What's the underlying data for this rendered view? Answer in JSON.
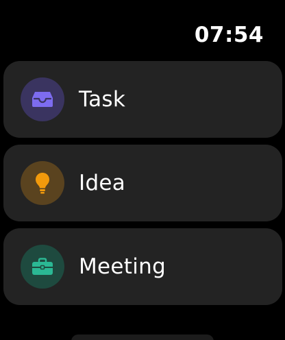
{
  "status_bar": {
    "time": "07:54"
  },
  "items": [
    {
      "label": "Task",
      "icon": "tray-icon",
      "icon_color": "#7d6cf0",
      "icon_bg": "#3a3460"
    },
    {
      "label": "Idea",
      "icon": "lightbulb-icon",
      "icon_color": "#f29a0c",
      "icon_bg": "#5a431f"
    },
    {
      "label": "Meeting",
      "icon": "briefcase-icon",
      "icon_color": "#2bb894",
      "icon_bg": "#1e4a3f"
    }
  ]
}
